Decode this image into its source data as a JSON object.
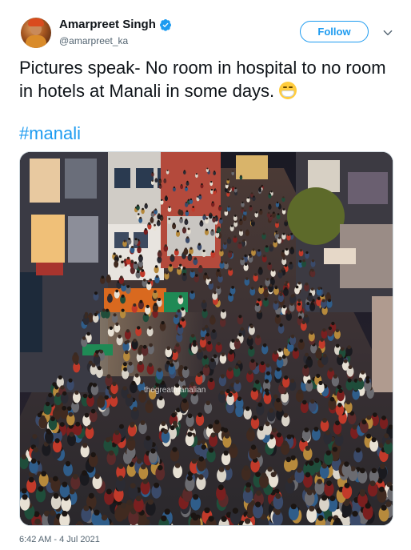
{
  "author": {
    "name": "Amarpreet Singh",
    "handle": "@amarpreet_ka",
    "verified_icon": "verified-badge-icon",
    "avatar": "avatar"
  },
  "actions": {
    "follow_label": "Follow",
    "more_icon": "chevron-down-icon"
  },
  "tweet": {
    "text": "Pictures speak- No room in hospital to no room in hotels at Manali in some days.",
    "emoji": "face-with-medical-mask",
    "hashtag": "#manali",
    "photo_description": "crowded-street-photo",
    "photo_watermark": "thegreatmanalian",
    "timestamp": "6:42 AM - 4 Jul 2021"
  },
  "colors": {
    "accent": "#1d9bf0",
    "text": "#0f1419",
    "muted": "#536471"
  }
}
